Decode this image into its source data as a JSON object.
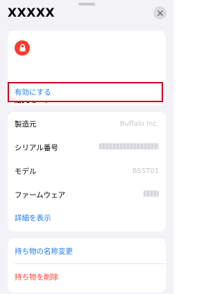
{
  "header": {
    "title": "XXXXX",
    "close_icon": "close-icon"
  },
  "lost_mode": {
    "icon": "lock-icon",
    "title": "紛失モード",
    "enable_label": "有効にする",
    "icon_color": "#ff3b30"
  },
  "info": {
    "rows": [
      {
        "label": "製造元",
        "value": "Buffalo Inc."
      },
      {
        "label": "シリアル番号",
        "value": ""
      },
      {
        "label": "モデル",
        "value": "BSST01"
      },
      {
        "label": "ファームウェア",
        "value": ""
      }
    ],
    "details_link": "詳細を表示"
  },
  "actions": {
    "rename_label": "持ち物の名称変更",
    "delete_label": "持ち物を削除"
  },
  "colors": {
    "link_blue": "#1e7bf0",
    "destructive_red": "#ff3b30",
    "highlight_border": "#d0021b"
  }
}
